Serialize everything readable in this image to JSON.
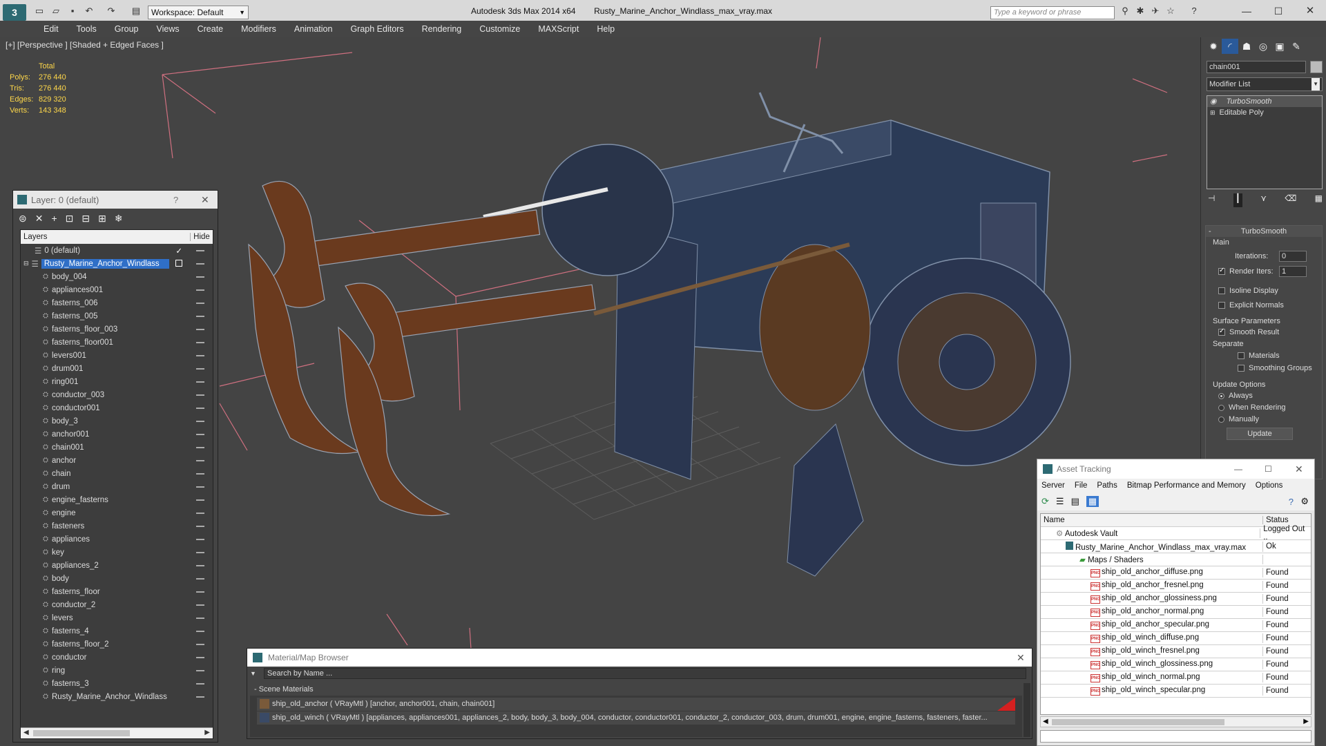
{
  "window": {
    "app_title": "Autodesk 3ds Max  2014 x64",
    "file_title": "Rusty_Marine_Anchor_Windlass_max_vray.max",
    "workspace": "Workspace: Default",
    "search_placeholder": "Type a keyword or phrase"
  },
  "menu": [
    "Edit",
    "Tools",
    "Group",
    "Views",
    "Create",
    "Modifiers",
    "Animation",
    "Graph Editors",
    "Rendering",
    "Customize",
    "MAXScript",
    "Help"
  ],
  "viewport": {
    "label": "[+] [Perspective ] [Shaded + Edged Faces ]",
    "stats": {
      "header": "Total",
      "rows": [
        {
          "label": "Polys:",
          "value": "276 440"
        },
        {
          "label": "Tris:",
          "value": "276 440"
        },
        {
          "label": "Edges:",
          "value": "829 320"
        },
        {
          "label": "Verts:",
          "value": "143 348"
        }
      ]
    }
  },
  "layers": {
    "title": "Layer: 0 (default)",
    "help": "?",
    "col_layers": "Layers",
    "col_hide": "Hide",
    "default_layer": "0 (default)",
    "active_layer": "Rusty_Marine_Anchor_Windlass",
    "objects": [
      "body_004",
      "appliances001",
      "fasterns_006",
      "fasterns_005",
      "fasterns_floor_003",
      "fasterns_floor001",
      "levers001",
      "drum001",
      "ring001",
      "conductor_003",
      "conductor001",
      "body_3",
      "anchor001",
      "chain001",
      "anchor",
      "chain",
      "drum",
      "engine_fasterns",
      "engine",
      "fasteners",
      "appliances",
      "key",
      "appliances_2",
      "body",
      "fasterns_floor",
      "conductor_2",
      "levers",
      "fasterns_4",
      "fasterns_floor_2",
      "conductor",
      "ring",
      "fasterns_3",
      "Rusty_Marine_Anchor_Windlass"
    ]
  },
  "command_panel": {
    "object_name": "chain001",
    "modifier_list": "Modifier List",
    "stack": [
      "TurboSmooth",
      "Editable Poly"
    ],
    "rollout_title": "TurboSmooth",
    "main_label": "Main",
    "iterations_label": "Iterations:",
    "iterations_value": "0",
    "render_iters_label": "Render Iters:",
    "render_iters_value": "1",
    "isoline": "Isoline Display",
    "explicit_normals": "Explicit Normals",
    "surface_params": "Surface Parameters",
    "smooth_result": "Smooth Result",
    "separate": "Separate",
    "materials": "Materials",
    "smoothing_groups": "Smoothing Groups",
    "update_options": "Update Options",
    "always": "Always",
    "when_rendering": "When Rendering",
    "manually": "Manually",
    "update_btn": "Update"
  },
  "asset_tracking": {
    "title": "Asset Tracking",
    "menu": [
      "Server",
      "File",
      "Paths",
      "Bitmap Performance and Memory",
      "Options"
    ],
    "col_name": "Name",
    "col_status": "Status",
    "vault": {
      "name": "Autodesk Vault",
      "status": "Logged Out .."
    },
    "file": {
      "name": "Rusty_Marine_Anchor_Windlass_max_vray.max",
      "status": "Ok"
    },
    "maps_label": "Maps / Shaders",
    "maps": [
      {
        "name": "ship_old_anchor_diffuse.png",
        "status": "Found"
      },
      {
        "name": "ship_old_anchor_fresnel.png",
        "status": "Found"
      },
      {
        "name": "ship_old_anchor_glossiness.png",
        "status": "Found"
      },
      {
        "name": "ship_old_anchor_normal.png",
        "status": "Found"
      },
      {
        "name": "ship_old_anchor_specular.png",
        "status": "Found"
      },
      {
        "name": "ship_old_winch_diffuse.png",
        "status": "Found"
      },
      {
        "name": "ship_old_winch_fresnel.png",
        "status": "Found"
      },
      {
        "name": "ship_old_winch_glossiness.png",
        "status": "Found"
      },
      {
        "name": "ship_old_winch_normal.png",
        "status": "Found"
      },
      {
        "name": "ship_old_winch_specular.png",
        "status": "Found"
      }
    ]
  },
  "material_browser": {
    "title": "Material/Map Browser",
    "search": "Search by Name ...",
    "section": "- Scene Materials",
    "materials": [
      "ship_old_anchor  ( VRayMtl ) [anchor, anchor001, chain, chain001]",
      "ship_old_winch  ( VRayMtl ) [appliances, appliances001, appliances_2, body, body_3, body_004, conductor, conductor001, conductor_2, conductor_003, drum, drum001, engine, engine_fasterns, fasteners, faster..."
    ]
  }
}
